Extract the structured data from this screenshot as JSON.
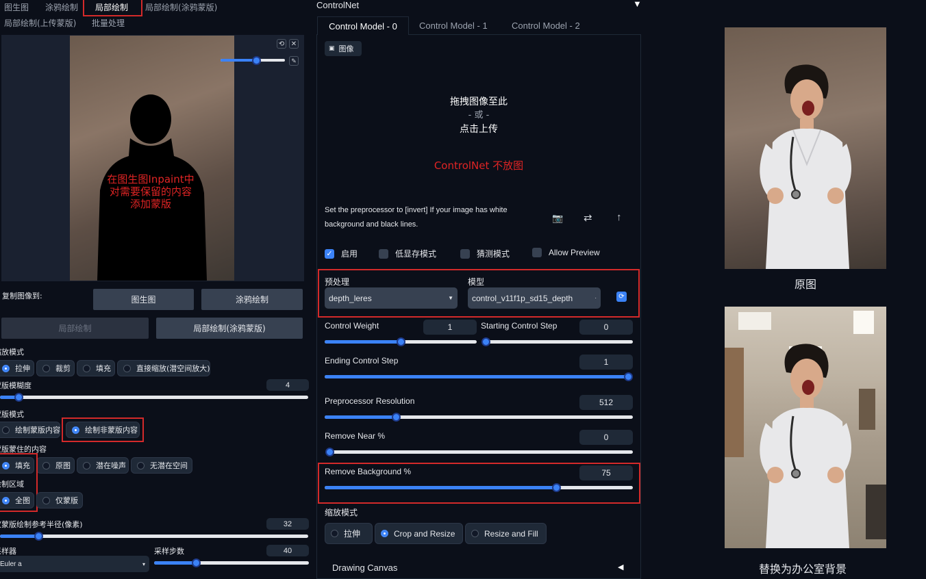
{
  "left": {
    "tabs": [
      "图生图",
      "涂鸦绘制",
      "局部绘制",
      "局部绘制(涂鸦蒙版)"
    ],
    "tabs2": [
      "局部绘制(上传蒙版)",
      "批量处理"
    ],
    "annotation": [
      "在图生图Inpaint中",
      "对需要保留的内容",
      "添加蒙版"
    ],
    "copy_to_label": "复制图像到:",
    "copy_buttons": [
      "图生图",
      "涂鸦绘制",
      "局部绘制",
      "局部绘制(涂鸦蒙版)"
    ],
    "resize_mode_label": "缩放模式",
    "resize_mode_options": [
      "拉伸",
      "裁剪",
      "填充",
      "直接缩放(潜空间放大)"
    ],
    "mask_blur_label": "蒙版模糊度",
    "mask_blur_value": "4",
    "mask_mode_label": "蒙版模式",
    "mask_mode_options": [
      "绘制蒙版内容",
      "绘制非蒙版内容"
    ],
    "masked_content_label": "蒙版蒙住的内容",
    "masked_content_options": [
      "填充",
      "原图",
      "潜在噪声",
      "无潜在空间"
    ],
    "inpaint_area_label": "绘制区域",
    "inpaint_area_options": [
      "全图",
      "仅蒙版"
    ],
    "padding_label": "仅蒙版绘制参考半径(像素)",
    "padding_value": "32",
    "sampler_label": "采样器",
    "sampler_value": "Euler a",
    "steps_label": "采样步数",
    "steps_value": "40",
    "brush_level": 0.55,
    "mask_blur_fraction": 0.06,
    "padding_fraction": 0.125,
    "steps_fraction": 0.27
  },
  "controlnet": {
    "title": "ControlNet",
    "model_tabs": [
      "Control Model - 0",
      "Control Model - 1",
      "Control Model - 2"
    ],
    "image_tab": "图像",
    "drop_text": [
      "拖拽图像至此",
      "- 或 -",
      "点击上传"
    ],
    "red_note": "ControlNet 不放图",
    "hint": [
      "Set the preprocessor to [invert] If your image has white",
      "background and black lines."
    ],
    "checkboxes": [
      {
        "label": "启用",
        "checked": true
      },
      {
        "label": "低显存模式",
        "checked": false
      },
      {
        "label": "猜测模式",
        "checked": false
      },
      {
        "label": "Allow Preview",
        "checked": false
      }
    ],
    "preprocessor_label": "预处理",
    "preprocessor_value": "depth_leres",
    "model_label": "模型",
    "model_value": "control_v11f1p_sd15_depth",
    "sliders": {
      "control_weight": {
        "label": "Control Weight",
        "value": "1",
        "fraction": 0.5
      },
      "starting_step": {
        "label": "Starting Control Step",
        "value": "0",
        "fraction": 0.0
      },
      "ending_step": {
        "label": "Ending Control Step",
        "value": "1",
        "fraction": 1.0
      },
      "preprocessor_resolution": {
        "label": "Preprocessor Resolution",
        "value": "512",
        "fraction": 0.23
      },
      "remove_near": {
        "label": "Remove Near %",
        "value": "0",
        "fraction": 0.0
      },
      "remove_background": {
        "label": "Remove Background %",
        "value": "75",
        "fraction": 0.75
      }
    },
    "resize_mode_label": "缩放模式",
    "resize_mode_options": [
      "拉伸",
      "Crop and Resize",
      "Resize and Fill"
    ],
    "drawing_canvas": "Drawing Canvas"
  },
  "right": {
    "caption_top": "原图",
    "caption_bottom": "替换为办公室背景"
  },
  "colors": {
    "accent": "#3b82f6",
    "annotation_red": "#d42a2a",
    "background": "#0b0f19"
  }
}
